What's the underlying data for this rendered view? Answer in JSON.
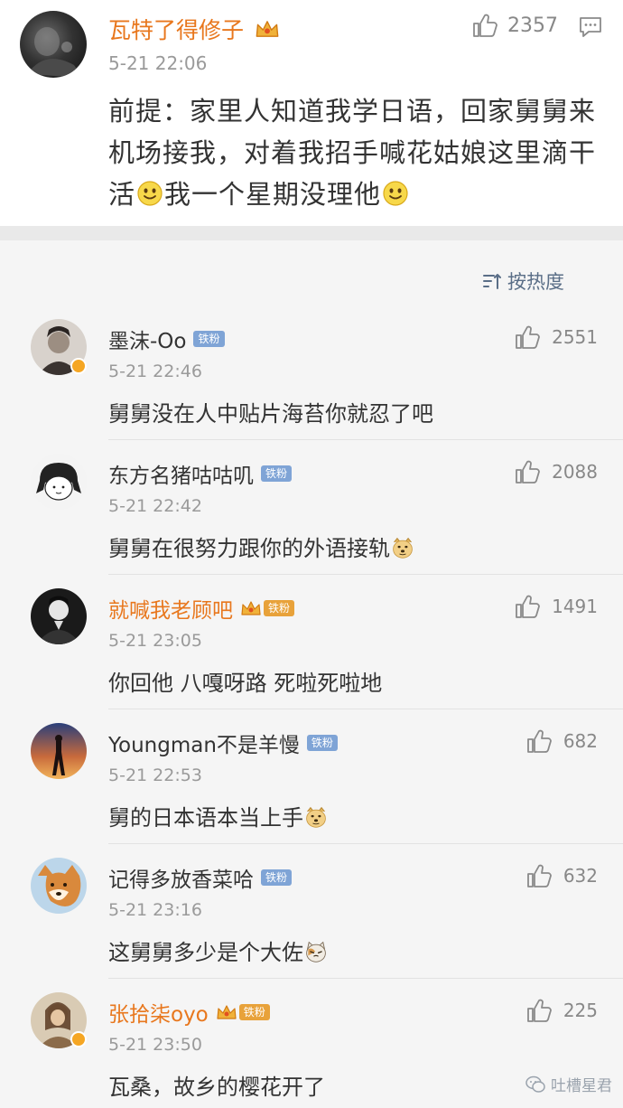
{
  "post": {
    "author": "瓦特了得修子",
    "time": "5-21 22:06",
    "likes": "2357",
    "body_part1": "前提：家里人知道我学日语，回家舅舅来机场接我，对着我招手喊花姑娘这里滴干活",
    "body_part2": "我一个星期没理他"
  },
  "sort_label": "按热度",
  "comments": [
    {
      "name": "墨沫-Oo",
      "badge": "铁粉",
      "time": "5-21 22:46",
      "likes": "2551",
      "text": "舅舅没在人中贴片海苔你就忍了吧"
    },
    {
      "name": "东方名猪咕咕叽",
      "badge": "铁粉",
      "time": "5-21 22:42",
      "likes": "2088",
      "text": "舅舅在很努力跟你的外语接轨"
    },
    {
      "name": "就喊我老顾吧",
      "badge": "铁粉",
      "time": "5-21 23:05",
      "likes": "1491",
      "text": "你回他 八嘎呀路 死啦死啦地"
    },
    {
      "name": "Youngman不是羊慢",
      "badge": "铁粉",
      "time": "5-21 22:53",
      "likes": "682",
      "text": "舅的日本语本当上手"
    },
    {
      "name": "记得多放香菜哈",
      "badge": "铁粉",
      "time": "5-21 23:16",
      "likes": "632",
      "text": "这舅舅多少是个大佐"
    },
    {
      "name": "张拾柒oyo",
      "badge": "铁粉",
      "time": "5-21 23:50",
      "likes": "225",
      "text": "瓦桑，故乡的樱花开了"
    }
  ],
  "watermark": "吐槽星君",
  "colors": {
    "vip_name": "#e8771d",
    "fan_badge": "#7fa4d6",
    "gold_badge": "#e8a23a",
    "sort": "#5a6e87"
  },
  "icons": [
    "thumb-up-icon",
    "comment-icon",
    "sort-icon",
    "smile-emoji",
    "doge-emoji",
    "cat-emoji",
    "crown-icon",
    "verified-icon",
    "wechat-icon"
  ]
}
